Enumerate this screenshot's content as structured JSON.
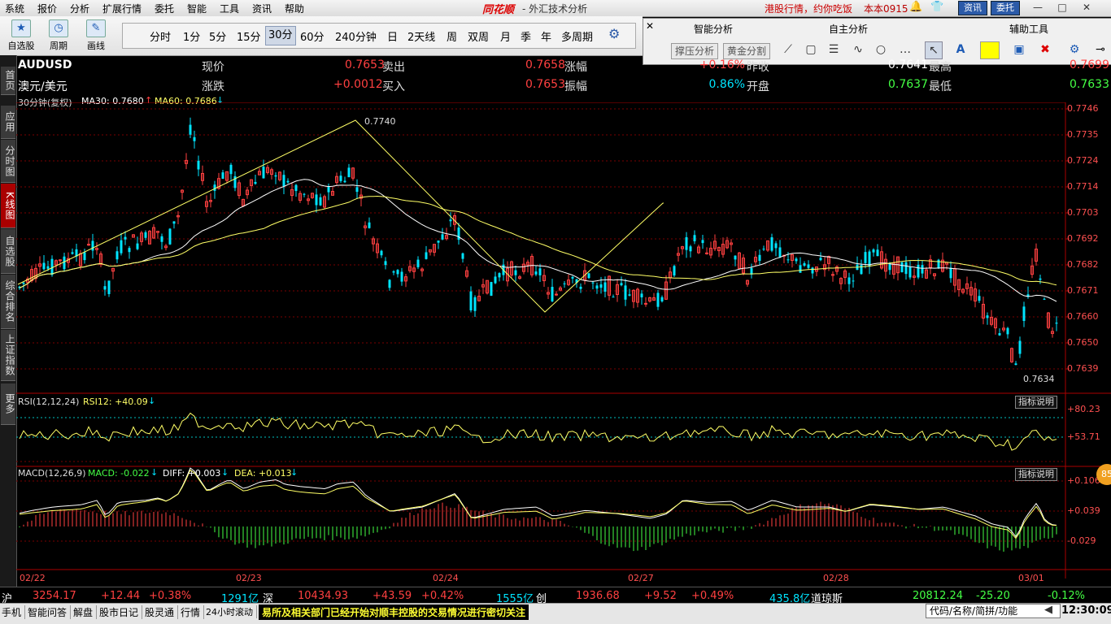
{
  "menu": {
    "items": [
      "系统",
      "报价",
      "分析",
      "扩展行情",
      "委托",
      "智能",
      "工具",
      "资讯",
      "帮助"
    ],
    "brand": "同花顺",
    "app_title": "- 外汇技术分析",
    "promo": "港股行情，约你吃饭",
    "user": "本本0915",
    "info_btn": "资讯",
    "trade_btn": "委托",
    "win_min": "—",
    "win_max": "□",
    "win_close": "✕"
  },
  "toolbar": {
    "self_select": "自选股",
    "period": "周期",
    "draw": "画线",
    "periods": [
      "分时",
      "1分",
      "5分",
      "15分",
      "30分",
      "60分",
      "240分钟",
      "日",
      "2天线",
      "周",
      "双周",
      "月",
      "季",
      "年",
      "多周期"
    ],
    "selected_period": "30分"
  },
  "right_panel": {
    "close": "✕",
    "h1": "智能分析",
    "h2": "自主分析",
    "h3": "辅助工具",
    "btn1": "撑压分析",
    "btn2": "黄金分割"
  },
  "left_tabs": [
    "首页",
    "应用",
    "分时图",
    "K线图",
    "自选股",
    "综合排名",
    "上证指数",
    "更多"
  ],
  "quote": {
    "symbol": "AUDUSD",
    "name": "澳元/美元",
    "price_lbl": "现价",
    "price": "0.7653",
    "sell_lbl": "卖出",
    "sell": "0.7658",
    "rise_lbl": "涨幅",
    "rise": "+0.16%",
    "prev_lbl": "昨收",
    "prev": "0.7641",
    "high_lbl": "最高",
    "high": "0.7699",
    "chg_lbl": "涨跌",
    "chg": "+0.0012",
    "buy_lbl": "买入",
    "buy": "0.7653",
    "amp_lbl": "振幅",
    "amp": "0.86%",
    "open_lbl": "开盘",
    "open": "0.7637",
    "low_lbl": "最低",
    "low": "0.7633"
  },
  "kline": {
    "legend": "30分钟(复权)",
    "ma30": "MA30: 0.7680",
    "ma60": "MA60: 0.7686",
    "price_labels": [
      "0.7746",
      "0.7735",
      "0.7724",
      "0.7714",
      "0.7703",
      "0.7692",
      "0.7682",
      "0.7671",
      "0.7660",
      "0.7650",
      "0.7639"
    ],
    "peak_label": "0.7740",
    "trough_label": "0.7634",
    "dates": [
      "02/22",
      "02/23",
      "02/24",
      "02/27",
      "02/28",
      "03/01"
    ]
  },
  "rsi": {
    "legend": "RSI(12,12,24)",
    "value": "RSI12: +40.09",
    "labels": [
      "+80.23",
      "+53.71"
    ],
    "help": "指标说明"
  },
  "macd": {
    "legend": "MACD(12,26,9)",
    "macd": "MACD: -0.022",
    "diff": "DIFF: +0.003",
    "dea": "DEA: +0.013",
    "labels": [
      "+0.106",
      "+0.039",
      "-0.029"
    ],
    "help": "指标说明",
    "badge": "85"
  },
  "index_bar": {
    "sh": "沪",
    "sh_val": "3254.17",
    "sh_chg": "+12.44",
    "sh_pct": "+0.38%",
    "sh_vol": "1291亿",
    "sz": "深",
    "sz_val": "10434.93",
    "sz_chg": "+43.59",
    "sz_pct": "+0.42%",
    "sz_vol": "1555亿",
    "cy": "创",
    "cy_val": "1936.68",
    "cy_chg": "+9.52",
    "cy_pct": "+0.49%",
    "cy_vol": "435.8亿",
    "dj": "道琼斯",
    "dj_val": "20812.24",
    "dj_chg": "-25.20",
    "dj_pct": "-0.12%"
  },
  "status_bar": {
    "items": [
      "手机",
      "智能问答",
      "解盘",
      "股市日记",
      "股灵通",
      "行情",
      "24小时滚动"
    ],
    "ticker": "易所及相关部门已经开始对顺丰控股的交易情况进行密切关注",
    "search_placeholder": "代码/名称/简拼/功能",
    "clock": "12:30:09"
  },
  "colors": {
    "up": "#ff4040",
    "down": "#00e5ff",
    "ma_white": "#ffffff",
    "ma_yellow": "#ffff66",
    "grid": "#7a0000"
  }
}
